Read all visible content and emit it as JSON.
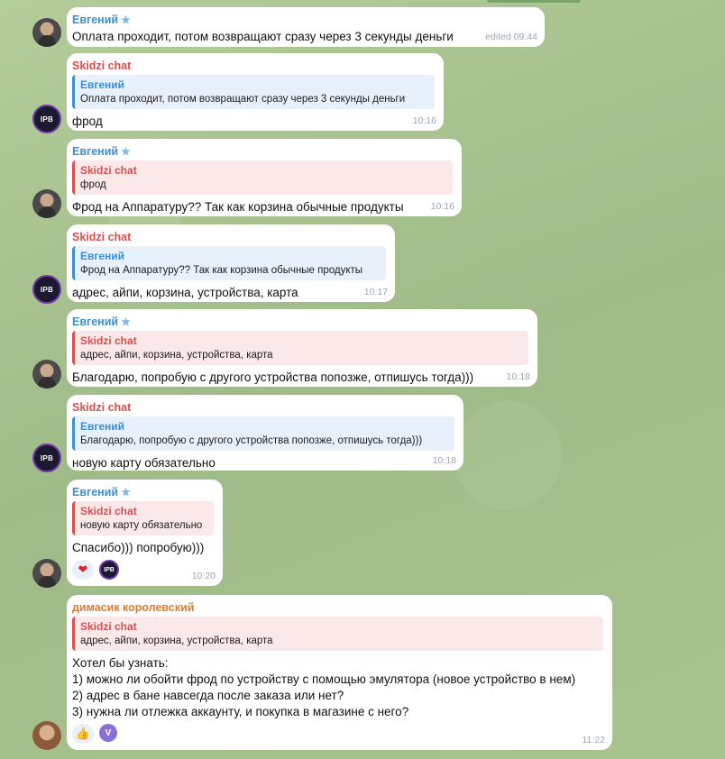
{
  "messages": [
    {
      "sender": "Евгений",
      "text": "Оплата проходит, потом возвращают сразу через 3 секунды деньги",
      "time": "edited 09:44"
    },
    {
      "sender": "Skidzi chat",
      "quote_name": "Евгений",
      "quote_text": "Оплата проходит, потом возвращают сразу через 3 секунды деньги",
      "text": "фрод",
      "time": "10:16"
    },
    {
      "sender": "Евгений",
      "quote_name": "Skidzi chat",
      "quote_text": "фрод",
      "text": "Фрод на Аппаратуру?? Так как корзина обычные продукты",
      "time": "10:16"
    },
    {
      "sender": "Skidzi chat",
      "quote_name": "Евгений",
      "quote_text": "Фрод на Аппаратуру?? Так как корзина обычные продукты",
      "text": "адрес, айпи, корзина, устройства, карта",
      "time": "10:17"
    },
    {
      "sender": "Евгений",
      "quote_name": "Skidzi chat",
      "quote_text": "адрес, айпи, корзина, устройства, карта",
      "text": "Благодарю, попробую с другого устройства попозже, отпишусь тогда)))",
      "time": "10:18"
    },
    {
      "sender": "Skidzi chat",
      "quote_name": "Евгений",
      "quote_text": "Благодарю, попробую с другого устройства попозже, отпишусь тогда)))",
      "text": "новую карту обязательно",
      "time": "10:18"
    },
    {
      "sender": "Евгений",
      "quote_name": "Skidzi chat",
      "quote_text": "новую карту обязательно",
      "text": "Спасибо))) попробую)))",
      "time": "10:20"
    },
    {
      "sender": "димасик королевский",
      "quote_name": "Skidzi chat",
      "quote_text": "адрес, айпи, корзина, устройства, карта",
      "lines": [
        "Хотел бы узнать:",
        "1) можно ли обойти фрод по устройству с помощью эмулятора (новое устройство в нем)",
        "2) адрес в бане навсегда после заказа или нет?",
        "3) нужна ли отлежка аккаунту, и покупка в магазине с него?"
      ],
      "time": "11:22"
    }
  ],
  "avatar_label": "IPB",
  "reaction_v_label": "V",
  "colors": {
    "blue_name": "#3a8fd6",
    "red_name": "#d84f4f",
    "orange_name": "#e07a2e",
    "bubble": "#ffffff",
    "background": "#a4c08f"
  }
}
